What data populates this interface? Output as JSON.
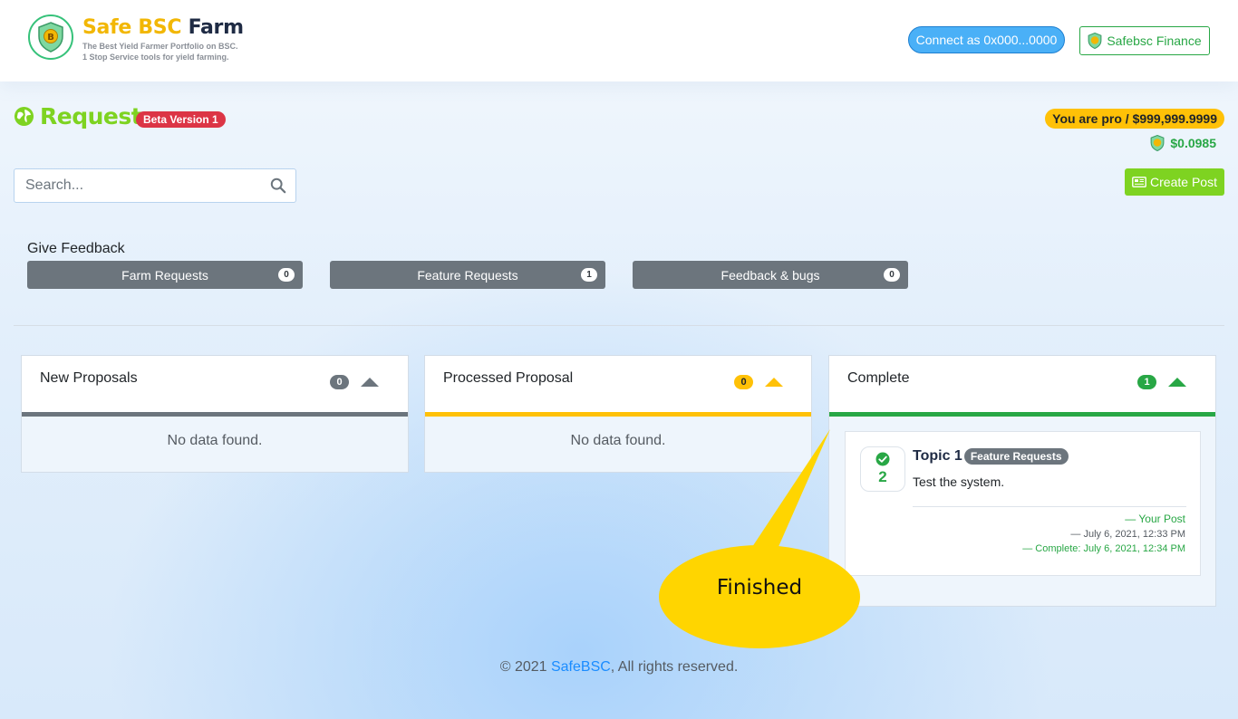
{
  "header": {
    "brand_part1": "Safe BSC",
    "brand_part2": "Farm",
    "tagline_line1": "The Best Yield Farmer Portfolio on BSC.",
    "tagline_line2": "1 Stop Service tools for yield farming.",
    "connect_label": "Connect as 0x000...0000",
    "finance_label": "Safebsc Finance"
  },
  "page": {
    "title": "Requests",
    "beta_badge": "Beta Version 1",
    "pro_label": "You are pro / $999,999.9999",
    "token_price": "$0.0985",
    "search_placeholder": "Search...",
    "create_label": "Create Post"
  },
  "feedback": {
    "heading": "Give Feedback",
    "categories": [
      {
        "label": "Farm Requests",
        "count": "0"
      },
      {
        "label": "Feature Requests",
        "count": "1"
      },
      {
        "label": "Feedback & bugs",
        "count": "0"
      }
    ]
  },
  "columns": [
    {
      "title": "New Proposals",
      "count": "0",
      "empty_text": "No data found.",
      "color": "#6c757d"
    },
    {
      "title": "Processed Proposal",
      "count": "0",
      "empty_text": "No data found.",
      "color": "#ffc107"
    },
    {
      "title": "Complete",
      "count": "1",
      "color": "#28a745"
    }
  ],
  "card": {
    "votes": "2",
    "topic": "Topic 1",
    "tag": "Feature Requests",
    "description": "Test the system.",
    "owner": "—  Your Post",
    "created": "— July 6, 2021, 12:33 PM",
    "completed": "—  Complete: July 6, 2021, 12:34 PM"
  },
  "callout": {
    "text": "Finished",
    "color": "#ffd500"
  },
  "footer": {
    "prefix": "© 2021 ",
    "link": "SafeBSC",
    "suffix": ", All rights reserved."
  }
}
